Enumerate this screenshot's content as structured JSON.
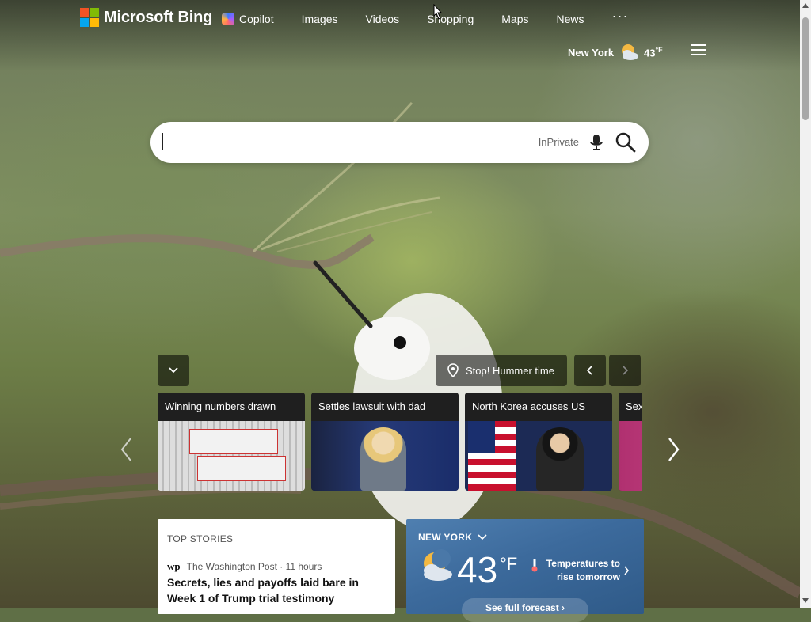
{
  "header": {
    "brand": "Microsoft Bing",
    "nav": [
      {
        "label": "Copilot",
        "icon": "copilot-icon"
      },
      {
        "label": "Images"
      },
      {
        "label": "Videos"
      },
      {
        "label": "Shopping"
      },
      {
        "label": "Maps"
      },
      {
        "label": "News"
      }
    ],
    "more_label": "···",
    "weather": {
      "city": "New York",
      "temp": "43",
      "unit": "°F",
      "icon": "partly-cloudy-night-icon"
    }
  },
  "search": {
    "value": "",
    "inprivate_label": "InPrivate"
  },
  "image_info": {
    "location_icon": "location-pin-icon",
    "title": "Stop! Hummer time"
  },
  "carousel": {
    "cards": [
      {
        "title": "Winning numbers drawn"
      },
      {
        "title": "Settles lawsuit with dad"
      },
      {
        "title": "North Korea accuses US"
      },
      {
        "title": "Sex"
      }
    ]
  },
  "top_stories": {
    "label": "TOP STORIES",
    "source_logo": "wp",
    "source": "The Washington Post · 11 hours",
    "headline": "Secrets, lies and payoffs laid bare in Week 1 of Trump trial testimony"
  },
  "weather_card": {
    "city": "NEW YORK",
    "temp": "43",
    "unit": "°F",
    "note": "Temperatures to rise tomorrow",
    "forecast_label": "See full forecast ›"
  }
}
